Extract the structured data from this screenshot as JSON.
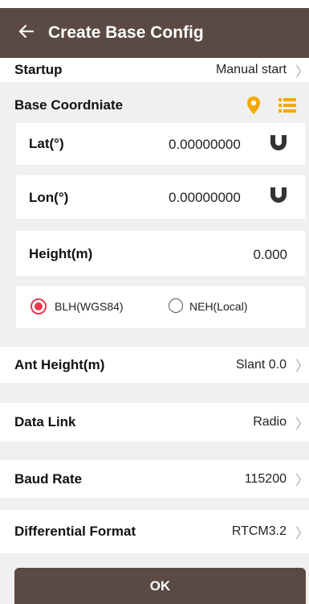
{
  "header": {
    "back_icon": "arrow-left-icon",
    "title": "Create Base Config"
  },
  "startup": {
    "label": "Startup",
    "value": "Manual start"
  },
  "base_coord": {
    "title": "Base Coordniate",
    "icons": [
      "location-pin-icon",
      "list-icon"
    ],
    "lat": {
      "label": "Lat(°)",
      "value": "0.00000000"
    },
    "lon": {
      "label": "Lon(°)",
      "value": "0.00000000"
    },
    "height": {
      "label": "Height(m)",
      "value": "0.000"
    },
    "radio": {
      "blh": "BLH(WGS84)",
      "neh": "NEH(Local)",
      "selected": "BLH(WGS84)"
    }
  },
  "ant_height": {
    "label": "Ant Height(m)",
    "value": "Slant 0.0"
  },
  "data_link": {
    "label": "Data Link",
    "value": "Radio"
  },
  "baud_rate": {
    "label": "Baud Rate",
    "value": "115200"
  },
  "diff_format": {
    "label": "Differential Format",
    "value": "RTCM3.2"
  },
  "ok_label": "OK",
  "colors": {
    "header": "#5b4943",
    "accent": "#f5a800",
    "radio": "#e8384f",
    "background": "#f0f0f0"
  }
}
